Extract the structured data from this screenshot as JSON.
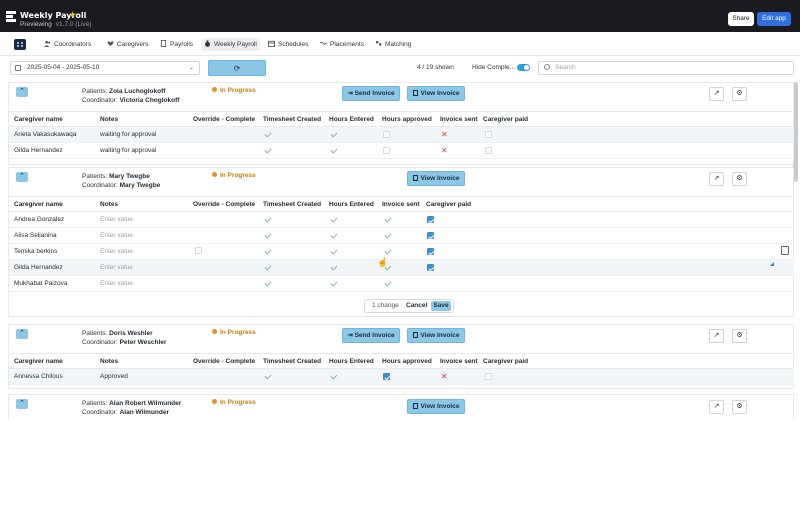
{
  "app": {
    "title": "Weekly Payroll",
    "subtitle": "Previewing",
    "version": "v1.7.0 (Live)",
    "share_label": "Share",
    "edit_label": "Edit app",
    "star_icon": "star-icon"
  },
  "nav": {
    "items": [
      {
        "label": "Coordinators",
        "icon": "people-icon"
      },
      {
        "label": "Caregivers",
        "icon": "heart-hand-icon"
      },
      {
        "label": "Payrolls",
        "icon": "document-icon"
      },
      {
        "label": "Weekly Payroll",
        "icon": "money-bag-icon",
        "active": true
      },
      {
        "label": "Schedules",
        "icon": "calendar-icon"
      },
      {
        "label": "Placements",
        "icon": "handshake-icon"
      },
      {
        "label": "Matching",
        "icon": "people-match-icon"
      }
    ]
  },
  "toolbar": {
    "date_range": "2025-05-04 - 2025-05-10",
    "shown": "4 / 19 shown",
    "hide_label": "Hide Comple...",
    "search_placeholder": "Search"
  },
  "columns": {
    "caregiver": "Caregiver name",
    "notes": "Notes",
    "override": "Override - Complete",
    "timesheet": "Timesheet Created",
    "hours_entered": "Hours Entered",
    "hours_approved": "Hours approved",
    "invoice_sent": "Invoice sent",
    "caregiver_paid": "Caregiver paid"
  },
  "groups": [
    {
      "patients_label": "Patients:",
      "patients": "Zoia Luchoglokoff",
      "coordinator_label": "Coordinator:",
      "coordinator": "Victoria Choglokoff",
      "status": "In Progress",
      "send_invoice": "Send Invoice",
      "view_invoice": "View Invoice",
      "rows": [
        {
          "name": "Arieta Vakasukawaqa",
          "notes": "waiting for approval"
        },
        {
          "name": "Gilda Hernandez",
          "notes": "waiting for approval"
        }
      ]
    },
    {
      "patients_label": "Patients:",
      "patients": "Mary Twegbe",
      "coordinator_label": "Coordinator:",
      "coordinator": "Mary Twegbe",
      "status": "In Progress",
      "view_invoice": "View Invoice",
      "notes_placeholder": "Enter value",
      "rows": [
        {
          "name": "Andrea Gonzalez"
        },
        {
          "name": "Alisa Selianina"
        },
        {
          "name": "Temika berkins"
        },
        {
          "name": "Gilda Hernandez"
        },
        {
          "name": "Mukhabat Paizova"
        }
      ],
      "change_bar": {
        "changes": "1 change",
        "cancel": "Cancel",
        "save": "Save"
      }
    },
    {
      "patients_label": "Patients:",
      "patients": "Doris Weshler",
      "coordinator_label": "Coordinator:",
      "coordinator": "Peter Weschler",
      "status": "In Progress",
      "send_invoice": "Send Invoice",
      "view_invoice": "View Invoice",
      "rows": [
        {
          "name": "Annessa Chilous",
          "notes": "Approved"
        }
      ]
    },
    {
      "patients_label": "Patients:",
      "patients": "Alan Robert Wilmunder",
      "coordinator_label": "Coordinator:",
      "coordinator": "Alan Wilmunder",
      "status": "In Progress",
      "view_invoice": "View Invoice"
    }
  ]
}
